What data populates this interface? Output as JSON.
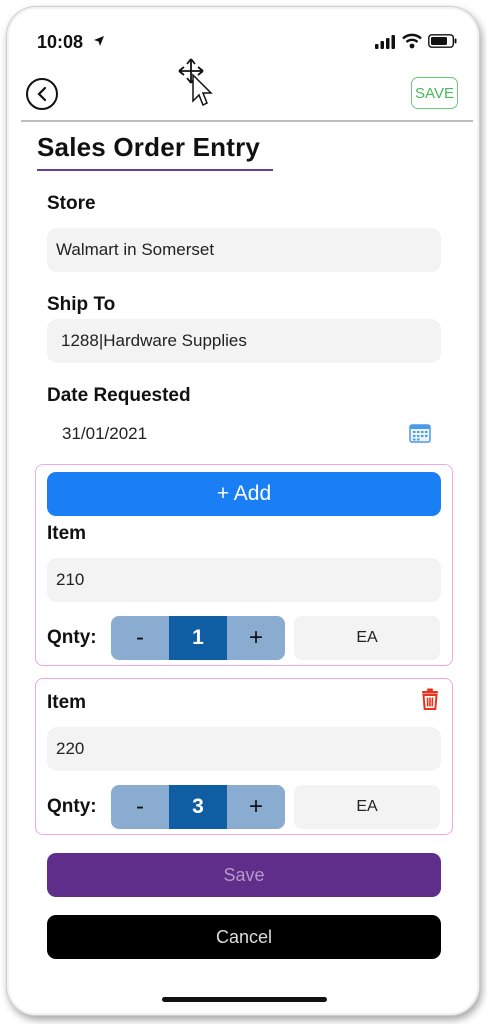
{
  "status_bar": {
    "time": "10:08"
  },
  "nav": {
    "save_label": "SAVE"
  },
  "page": {
    "title": "Sales Order Entry"
  },
  "form": {
    "store_label": "Store",
    "store_value": "Walmart in Somerset",
    "ship_to_label": "Ship To",
    "ship_to_value": "1288|Hardware Supplies",
    "date_label": "Date Requested",
    "date_value": "31/01/2021"
  },
  "add_button_label": "+ Add",
  "items": [
    {
      "item_label": "Item",
      "item_value": "210",
      "qty_label": "Qnty:",
      "qty": "1",
      "minus": "-",
      "plus": "+",
      "uom": "EA"
    },
    {
      "item_label": "Item",
      "item_value": "220",
      "qty_label": "Qnty:",
      "qty": "3",
      "minus": "-",
      "plus": "+",
      "uom": "EA"
    }
  ],
  "actions": {
    "save_label": "Save",
    "cancel_label": "Cancel"
  },
  "colors": {
    "add_button": "#1a7ff5",
    "save_button": "#5f2e8a",
    "cancel_button": "#000000",
    "stepper_value": "#0f5ea3",
    "stepper_buttons": "#89acd0",
    "card_border": "#f0a8e6",
    "top_save": "#49b95a",
    "delete": "#e8321e"
  },
  "icons": [
    "location-arrow-icon",
    "signal-icon",
    "wifi-icon",
    "battery-icon",
    "back-icon",
    "move-cursor-icon",
    "calendar-icon",
    "trash-icon"
  ]
}
